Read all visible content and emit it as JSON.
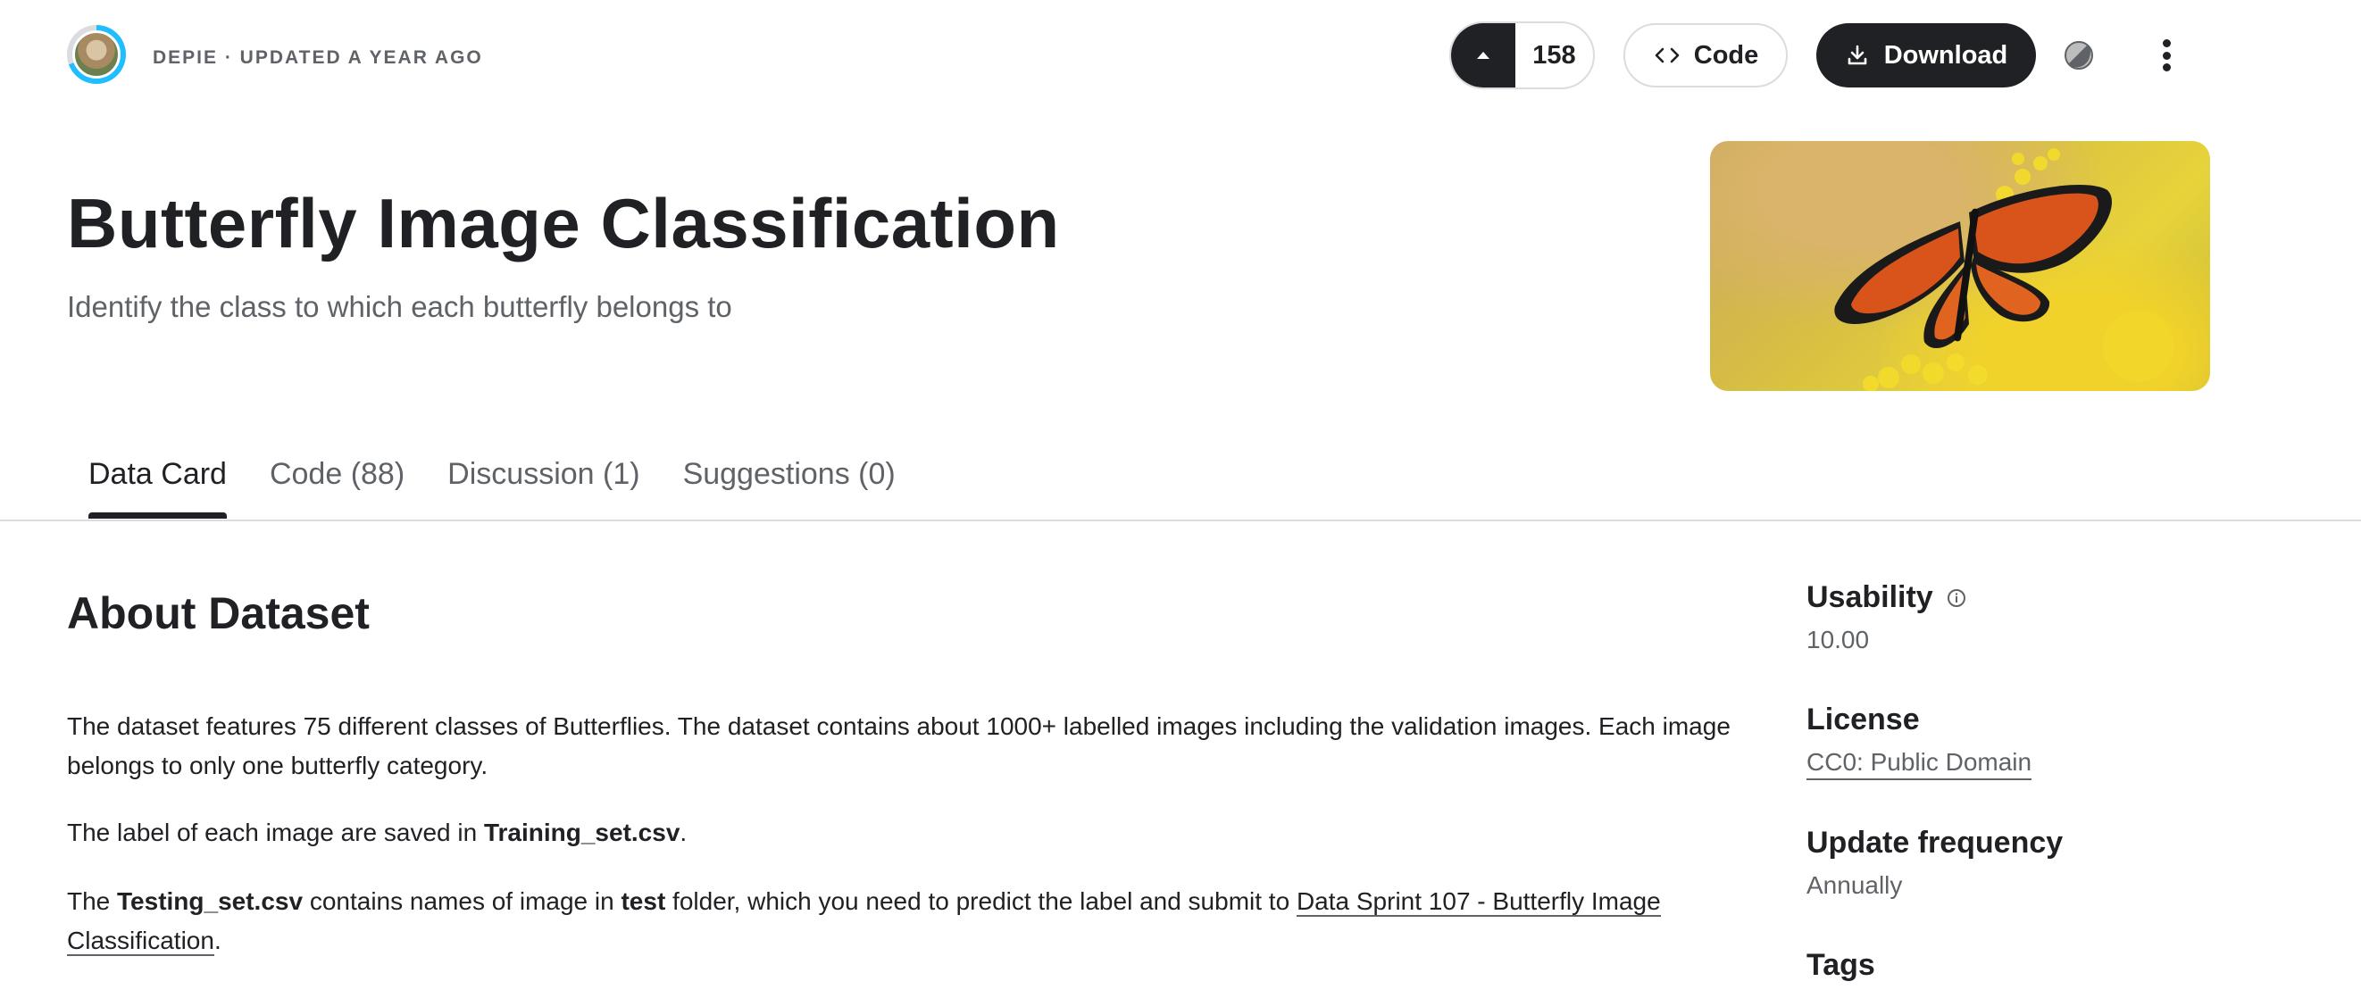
{
  "header": {
    "author_line": "DEPIE · UPDATED A YEAR AGO",
    "vote_count": "158",
    "code_label": "Code",
    "download_label": "Download"
  },
  "dataset": {
    "title": "Butterfly Image Classification",
    "subtitle": "Identify the class to which each butterfly belongs to"
  },
  "tabs": [
    {
      "label": "Data Card",
      "active": true
    },
    {
      "label": "Code (88)",
      "active": false
    },
    {
      "label": "Discussion (1)",
      "active": false
    },
    {
      "label": "Suggestions (0)",
      "active": false
    }
  ],
  "about": {
    "heading": "About Dataset",
    "p1": "The dataset features 75 different classes of Butterflies. The dataset contains about 1000+ labelled images including the validation images. Each image belongs to only one butterfly category.",
    "p2_pre": "The label of each image are saved in ",
    "p2_bold": "Training_set.csv",
    "p2_post": ".",
    "p3_pre": "The ",
    "p3_bold1": "Testing_set.csv",
    "p3_mid1": " contains names of image in ",
    "p3_bold2": "test",
    "p3_mid2": " folder, which you need to predict the label and submit to ",
    "p3_link": "Data Sprint 107 - Butterfly Image Classification",
    "p3_post": "."
  },
  "sidebar": {
    "usability_label": "Usability",
    "usability_value": "10.00",
    "license_label": "License",
    "license_value": "CC0: Public Domain",
    "frequency_label": "Update frequency",
    "frequency_value": "Annually",
    "tags_label": "Tags"
  },
  "icons": {
    "upvote": "caret-up-icon",
    "code": "code-brackets-icon",
    "download": "download-icon",
    "theme": "theme-toggle-icon",
    "more": "more-vertical-icon",
    "info": "info-icon"
  },
  "colors": {
    "primary": "#202124",
    "secondary_text": "#5f6368",
    "border": "#dadce0",
    "accent_ring": "#20beff"
  }
}
